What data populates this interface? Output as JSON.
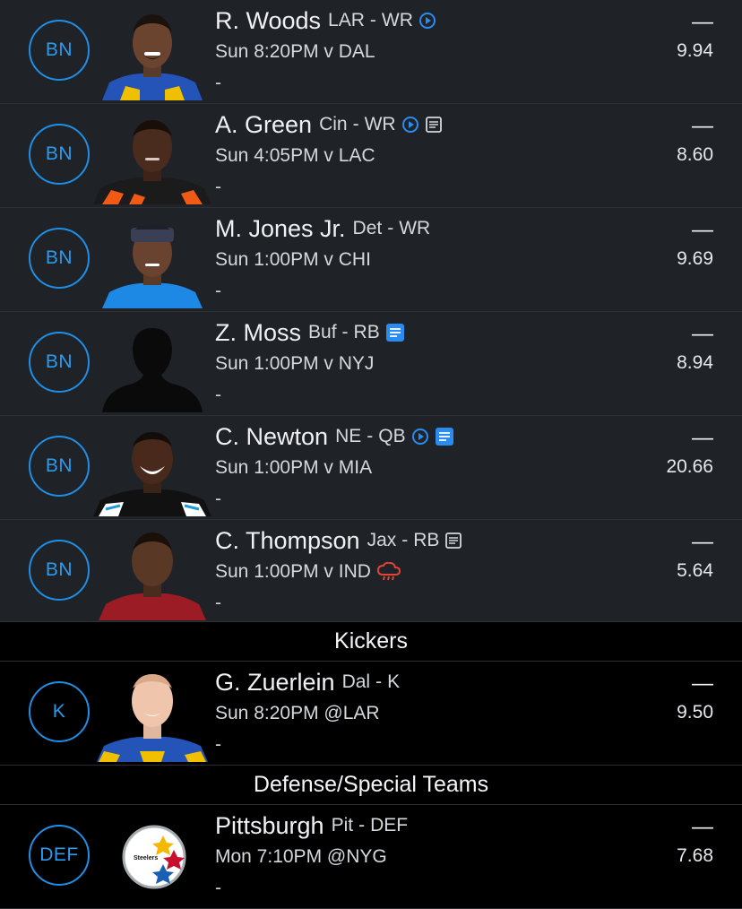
{
  "players": [
    {
      "slot": "BN",
      "name": "R. Woods",
      "team": "LAR",
      "sep": "-",
      "pos": "WR",
      "game": "Sun 8:20PM v DAL",
      "status": "-",
      "dash": "—",
      "proj": "9.94",
      "icons": [
        "video"
      ],
      "weather": false
    },
    {
      "slot": "BN",
      "name": "A. Green",
      "team": "Cin",
      "sep": "-",
      "pos": "WR",
      "game": "Sun 4:05PM v LAC",
      "status": "-",
      "dash": "—",
      "proj": "8.60",
      "icons": [
        "video",
        "note"
      ],
      "weather": false
    },
    {
      "slot": "BN",
      "name": "M. Jones Jr.",
      "team": "Det",
      "sep": "-",
      "pos": "WR",
      "game": "Sun 1:00PM v CHI",
      "status": "-",
      "dash": "—",
      "proj": "9.69",
      "icons": [],
      "weather": false
    },
    {
      "slot": "BN",
      "name": "Z. Moss",
      "team": "Buf",
      "sep": "-",
      "pos": "RB",
      "game": "Sun 1:00PM v NYJ",
      "status": "-",
      "dash": "—",
      "proj": "8.94",
      "icons": [
        "note-new"
      ],
      "weather": false
    },
    {
      "slot": "BN",
      "name": "C. Newton",
      "team": "NE",
      "sep": "-",
      "pos": "QB",
      "game": "Sun 1:00PM v MIA",
      "status": "-",
      "dash": "—",
      "proj": "20.66",
      "icons": [
        "video",
        "note-new"
      ],
      "weather": false
    },
    {
      "slot": "BN",
      "name": "C. Thompson",
      "team": "Jax",
      "sep": "-",
      "pos": "RB",
      "game": "Sun 1:00PM v IND",
      "status": "-",
      "dash": "—",
      "proj": "5.64",
      "icons": [
        "note"
      ],
      "weather": true
    }
  ],
  "sections": {
    "kickers": "Kickers",
    "defense": "Defense/Special Teams"
  },
  "kicker": {
    "slot": "K",
    "name": "G. Zuerlein",
    "team": "Dal",
    "sep": "-",
    "pos": "K",
    "game": "Sun 8:20PM @LAR",
    "status": "-",
    "dash": "—",
    "proj": "9.50"
  },
  "defense": {
    "slot": "DEF",
    "name": "Pittsburgh",
    "team": "Pit",
    "sep": "-",
    "pos": "DEF",
    "game": "Mon 7:10PM @NYG",
    "status": "-",
    "dash": "—",
    "proj": "7.68",
    "logo_text": "Steelers"
  },
  "colors": {
    "accent": "#1f8fe6",
    "row_bg": "#1f2227",
    "header_bg": "#000000",
    "weather": "#e0443a",
    "note_new": "#2a8cf0"
  }
}
